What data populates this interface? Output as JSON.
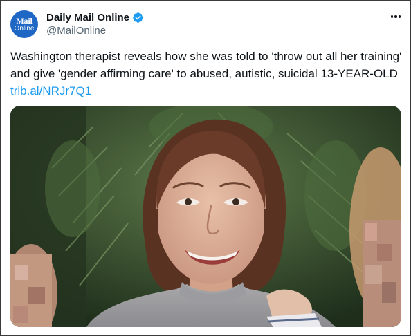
{
  "account": {
    "display_name": "Daily Mail Online",
    "handle": "@MailOnline",
    "avatar_line1": "Mail",
    "avatar_line2": "Online",
    "verified": true
  },
  "tweet": {
    "text": "Washington therapist reveals how she was told to 'throw out all her training' and give 'gender affirming care' to abused, autistic, suicidal 13-YEAR-OLD ",
    "link_text": "trib.al/NRJr7Q1"
  },
  "icons": {
    "verified": "verified-badge-icon",
    "more": "more-options-icon"
  },
  "colors": {
    "link": "#1d9bf0",
    "verified": "#1d9bf0",
    "avatar_bg": "#1f67c4",
    "handle": "#536471"
  }
}
